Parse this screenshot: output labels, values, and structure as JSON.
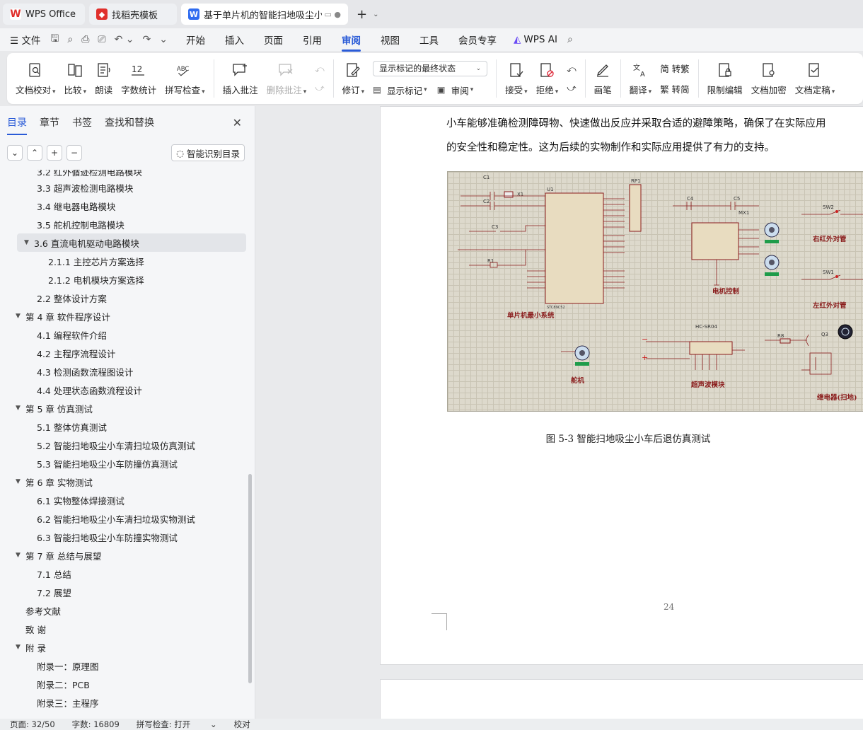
{
  "tabs": [
    {
      "label": "WPS Office",
      "icon": "wps-logo-icon"
    },
    {
      "label": "找稻壳模板",
      "icon": "template-icon"
    },
    {
      "label": "基于单片机的智能扫地吸尘小车",
      "icon": "word-doc-icon"
    }
  ],
  "menu": {
    "file_label": "文件",
    "tabs": [
      "开始",
      "插入",
      "页面",
      "引用",
      "审阅",
      "视图",
      "工具",
      "会员专享"
    ],
    "active_tab": "审阅",
    "wps_ai_label": "WPS AI"
  },
  "ribbon": {
    "doc_check": "文档校对",
    "compare": "比较",
    "read_aloud": "朗读",
    "word_count": "字数统计",
    "spell_check": "拼写检查",
    "insert_comment": "插入批注",
    "delete_comment": "删除批注",
    "track_changes": "修订",
    "markup_mode": "显示标记的最终状态",
    "show_markup": "显示标记",
    "review": "审阅",
    "accept": "接受",
    "reject": "拒绝",
    "pen": "画笔",
    "translate": "翻译",
    "to_traditional": "简 转繁",
    "to_simplified": "繁 转简",
    "restrict_edit": "限制编辑",
    "encrypt": "文档加密",
    "finalize": "文档定稿"
  },
  "leftpanel": {
    "tabs": [
      "目录",
      "章节",
      "书签",
      "查找和替换"
    ],
    "active_tab": "目录",
    "ai_toc_label": "智能识别目录",
    "toc": [
      {
        "text": "3.2  红外循迹检测电路模块",
        "level": 3,
        "arrow": ""
      },
      {
        "text": "3.3 超声波检测电路模块",
        "level": 3,
        "arrow": ""
      },
      {
        "text": "3.4  继电器电路模块",
        "level": 3,
        "arrow": ""
      },
      {
        "text": "3.5  舵机控制电路模块",
        "level": 3,
        "arrow": ""
      },
      {
        "text": "3.6  直流电机驱动电路模块",
        "level": 2,
        "arrow": "▼",
        "selected": true
      },
      {
        "text": "2.1.1  主控芯片方案选择",
        "level": 4,
        "arrow": ""
      },
      {
        "text": "2.1.2  电机模块方案选择",
        "level": 4,
        "arrow": ""
      },
      {
        "text": "2.2  整体设计方案",
        "level": 3,
        "arrow": ""
      },
      {
        "text": "第 4 章  软件程序设计",
        "level": 1,
        "arrow": "▼"
      },
      {
        "text": "4.1  编程软件介绍",
        "level": 3,
        "arrow": ""
      },
      {
        "text": "4.2  主程序流程设计",
        "level": 3,
        "arrow": ""
      },
      {
        "text": "4.3  检测函数流程图设计",
        "level": 3,
        "arrow": ""
      },
      {
        "text": "4.4  处理状态函数流程设计",
        "level": 3,
        "arrow": ""
      },
      {
        "text": "第 5 章  仿真测试",
        "level": 1,
        "arrow": "▼"
      },
      {
        "text": "5.1  整体仿真测试",
        "level": 3,
        "arrow": ""
      },
      {
        "text": "5.2  智能扫地吸尘小车清扫垃圾仿真测试",
        "level": 3,
        "arrow": ""
      },
      {
        "text": "5.3  智能扫地吸尘小车防撞仿真测试",
        "level": 3,
        "arrow": ""
      },
      {
        "text": "第 6 章  实物测试",
        "level": 1,
        "arrow": "▼"
      },
      {
        "text": "6.1  实物整体焊接测试",
        "level": 3,
        "arrow": ""
      },
      {
        "text": "6.2  智能扫地吸尘小车清扫垃圾实物测试",
        "level": 3,
        "arrow": ""
      },
      {
        "text": "6.3  智能扫地吸尘小车防撞实物测试",
        "level": 3,
        "arrow": ""
      },
      {
        "text": "第 7 章  总结与展望",
        "level": 1,
        "arrow": "▼"
      },
      {
        "text": "7.1  总结",
        "level": 3,
        "arrow": ""
      },
      {
        "text": "7.2  展望",
        "level": 3,
        "arrow": ""
      },
      {
        "text": "参考文献",
        "level": 1,
        "arrow": ""
      },
      {
        "text": "致   谢",
        "level": 1,
        "arrow": ""
      },
      {
        "text": "附   录",
        "level": 1,
        "arrow": "▼"
      },
      {
        "text": "附录一：原理图",
        "level": 3,
        "arrow": ""
      },
      {
        "text": "附录二：PCB",
        "level": 3,
        "arrow": ""
      },
      {
        "text": "附录三：主程序",
        "level": 3,
        "arrow": ""
      }
    ]
  },
  "document": {
    "line1": "小车能够准确检测障碍物、快速做出反应并采取合适的避障策略，确保了在实际应用",
    "line2": "的安全性和稳定性。这为后续的实物制作和实际应用提供了有力的支持。",
    "caption": "图 5-3 智能扫地吸尘小车后退仿真测试",
    "page_number": "24",
    "figure_labels": {
      "mcu": "单片机最小系统",
      "motor": "电机控制",
      "right_ir": "右红外对管",
      "left_ir": "左红外对管",
      "servo": "舵机",
      "ultrasonic": "超声波模块",
      "relay": "继电器(扫地)",
      "u1": "U1",
      "u1_part": "STC89C52",
      "rp1": "RP1",
      "hcsr04": "HC-SR04",
      "mx1": "MX1",
      "q3": "Q3",
      "sw1": "SW1",
      "sw2": "SW2",
      "c1": "C1",
      "c2": "C2",
      "c3": "C3",
      "c4": "C4",
      "c5": "C5",
      "x1": "X1",
      "r1": "R1",
      "r8": "R8"
    }
  },
  "statusbar": {
    "page": "页面: 32/50",
    "words": "字数: 16809",
    "spell": "拼写检查: 打开",
    "proof": "校对"
  }
}
